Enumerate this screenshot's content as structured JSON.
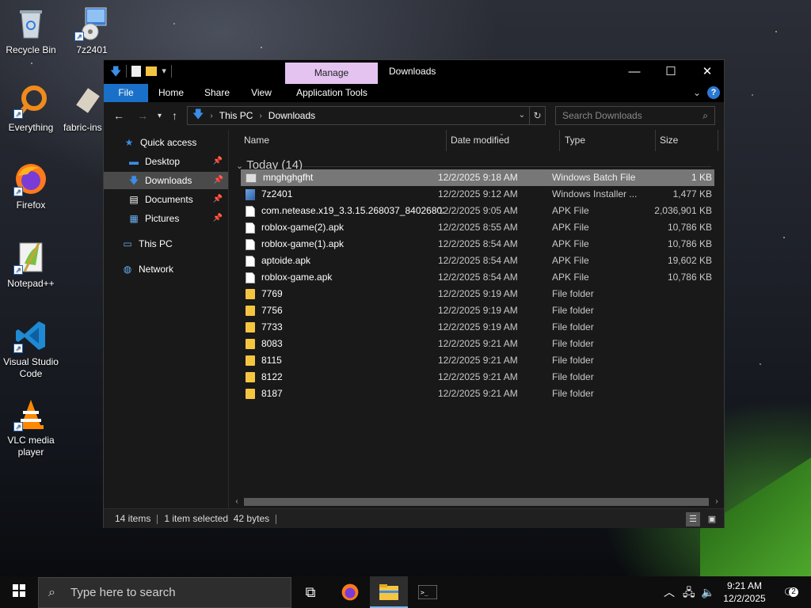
{
  "desktop": {
    "icons": [
      {
        "label": "Recycle Bin",
        "icon": "recycle-bin-icon"
      },
      {
        "label": "7z2401",
        "icon": "installer-icon"
      },
      {
        "label": "Everything",
        "icon": "everything-search-icon"
      },
      {
        "label": "fabric-ins",
        "icon": "jar-file-icon"
      },
      {
        "label": "Firefox",
        "icon": "firefox-icon"
      },
      {
        "label": "Notepad++",
        "icon": "notepadpp-icon"
      },
      {
        "label": "Visual Studio Code",
        "icon": "vscode-icon"
      },
      {
        "label": "VLC media player",
        "icon": "vlc-icon"
      }
    ]
  },
  "window": {
    "title": "Downloads",
    "manage_tab": "Manage",
    "ribbon_tabs": [
      "File",
      "Home",
      "Share",
      "View",
      "Application Tools"
    ],
    "address": {
      "segments": [
        "This PC",
        "Downloads"
      ]
    },
    "search_placeholder": "Search Downloads",
    "nav": {
      "quick_access": "Quick access",
      "items": [
        {
          "label": "Desktop",
          "pinned": true
        },
        {
          "label": "Downloads",
          "pinned": true,
          "selected": true
        },
        {
          "label": "Documents",
          "pinned": true
        },
        {
          "label": "Pictures",
          "pinned": true
        }
      ],
      "this_pc": "This PC",
      "network": "Network"
    },
    "columns": [
      "Name",
      "Date modified",
      "Type",
      "Size"
    ],
    "group_label": "Today (14)",
    "files": [
      {
        "name": "mnghghgfht",
        "date": "12/2/2025 9:18 AM",
        "type": "Windows Batch File",
        "size": "1 KB",
        "kind": "bat",
        "selected": true
      },
      {
        "name": "7z2401",
        "date": "12/2/2025 9:12 AM",
        "type": "Windows Installer ...",
        "size": "1,477 KB",
        "kind": "inst"
      },
      {
        "name": "com.netease.x19_3.3.15.268037_84026803...",
        "date": "12/2/2025 9:05 AM",
        "type": "APK File",
        "size": "2,036,901 KB",
        "kind": "file"
      },
      {
        "name": "roblox-game(2).apk",
        "date": "12/2/2025 8:55 AM",
        "type": "APK File",
        "size": "10,786 KB",
        "kind": "file"
      },
      {
        "name": "roblox-game(1).apk",
        "date": "12/2/2025 8:54 AM",
        "type": "APK File",
        "size": "10,786 KB",
        "kind": "file"
      },
      {
        "name": "aptoide.apk",
        "date": "12/2/2025 8:54 AM",
        "type": "APK File",
        "size": "19,602 KB",
        "kind": "file"
      },
      {
        "name": "roblox-game.apk",
        "date": "12/2/2025 8:54 AM",
        "type": "APK File",
        "size": "10,786 KB",
        "kind": "file"
      },
      {
        "name": "7769",
        "date": "12/2/2025 9:19 AM",
        "type": "File folder",
        "size": "",
        "kind": "folder"
      },
      {
        "name": "7756",
        "date": "12/2/2025 9:19 AM",
        "type": "File folder",
        "size": "",
        "kind": "folder"
      },
      {
        "name": "7733",
        "date": "12/2/2025 9:19 AM",
        "type": "File folder",
        "size": "",
        "kind": "folder"
      },
      {
        "name": "8083",
        "date": "12/2/2025 9:21 AM",
        "type": "File folder",
        "size": "",
        "kind": "folder"
      },
      {
        "name": "8115",
        "date": "12/2/2025 9:21 AM",
        "type": "File folder",
        "size": "",
        "kind": "folder"
      },
      {
        "name": "8122",
        "date": "12/2/2025 9:21 AM",
        "type": "File folder",
        "size": "",
        "kind": "folder"
      },
      {
        "name": "8187",
        "date": "12/2/2025 9:21 AM",
        "type": "File folder",
        "size": "",
        "kind": "folder"
      }
    ],
    "status": {
      "items": "14 items",
      "selected": "1 item selected",
      "size": "42 bytes"
    }
  },
  "taskbar": {
    "search_placeholder": "Type here to search",
    "time": "9:21 AM",
    "date": "12/2/2025",
    "notifications": "2"
  },
  "colors": {
    "accent": "#1a70c8",
    "manage_tab": "#e4c3f1",
    "selection": "#777777"
  }
}
